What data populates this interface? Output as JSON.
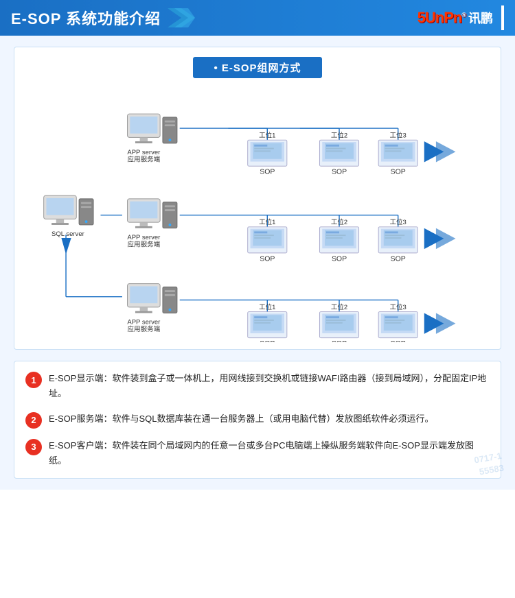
{
  "header": {
    "title": "E-SOP 系统功能介绍",
    "logo_sunpn": "5UnPn",
    "logo_xunpeng": "讯鹏",
    "logo_reg": "®"
  },
  "network": {
    "title": "E-SOP组网方式",
    "nodes": {
      "sql_server_label": "SQL server",
      "app_server_label1": "APP server\n应用服务端",
      "app_server_label2": "APP server\n应用服务端",
      "app_server_label3": "APP server\n应用服务端",
      "workstation_labels": [
        "工位1",
        "工位2",
        "工位3"
      ],
      "sop_label": "SOP"
    }
  },
  "descriptions": [
    {
      "num": "1",
      "text": "E-SOP显示端：软件装到盒子或一体机上，用网线接到交换机或链接WAFI路由器（接到局域网），分配固定IP地址。"
    },
    {
      "num": "2",
      "text": "E-SOP服务端：软件与SQL数据库装在通一台服务器上（或用电脑代替）发放图纸软件必须运行。"
    },
    {
      "num": "3",
      "text": "E-SOP客户端：软件装在同个局域网内的任意一台或多台PC电脑端上操纵服务端软件向E-SOP显示端发放图纸。"
    }
  ],
  "watermark": {
    "line1": "0717-1",
    "line2": "55583"
  }
}
